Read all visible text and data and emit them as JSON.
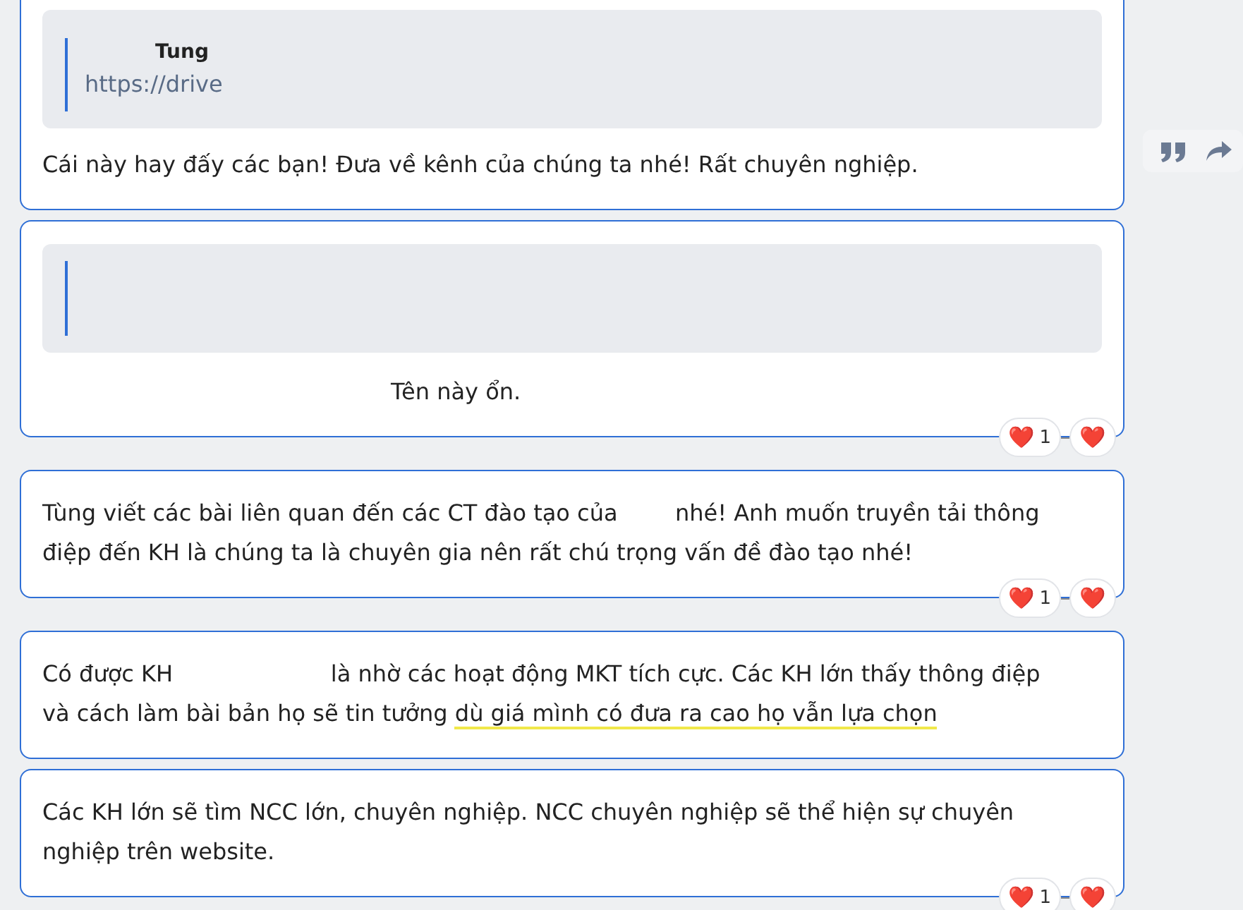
{
  "messages": [
    {
      "kind": "quoted",
      "quote": {
        "author": "Tung",
        "text": "https://drive"
      },
      "lines": [
        [
          {
            "text": "Cái này hay đấy các bạn! Đưa về kênh của chúng ta nhé! Rất chuyên nghiệp.",
            "underlined": false
          }
        ]
      ]
    },
    {
      "kind": "reply",
      "lines": [
        [
          {
            "text": "Tên này ổn.",
            "underlined": false
          }
        ]
      ],
      "reactions": [
        {
          "emoji": "❤️",
          "count": "1"
        },
        {
          "emoji": "❤️"
        }
      ]
    },
    {
      "kind": "plain",
      "lines": [
        [
          {
            "text": "Tùng viết các bài liên quan đến các CT đào tạo của        nhé! Anh muốn truyền tải thông",
            "underlined": false
          }
        ],
        [
          {
            "text": "điệp đến KH là chúng ta là chuyên gia nên rất chú trọng vấn đề đào tạo nhé!",
            "underlined": false
          }
        ]
      ],
      "reactions": [
        {
          "emoji": "❤️",
          "count": "1"
        },
        {
          "emoji": "❤️"
        }
      ]
    },
    {
      "kind": "plain",
      "lines": [
        [
          {
            "text": "Có được KH                      là nhờ các hoạt động MKT tích cực. Các KH lớn thấy thông điệp",
            "underlined": false
          }
        ],
        [
          {
            "text": "và cách làm bài bản họ sẽ tin tưởng ",
            "underlined": false
          },
          {
            "text": "dù giá mình có đưa ra cao họ vẫn lựa chọn",
            "underlined": true
          }
        ]
      ]
    },
    {
      "kind": "plain",
      "lines": [
        [
          {
            "text": "Các KH lớn sẽ tìm NCC lớn, chuyên nghiệp. NCC chuyên nghiệp sẽ thể hiện sự chuyên",
            "underlined": false
          }
        ],
        [
          {
            "text": "nghiệp trên website.",
            "underlined": false
          }
        ]
      ],
      "reactions": [
        {
          "emoji": "❤️",
          "count": "1"
        },
        {
          "emoji": "❤️"
        }
      ]
    }
  ]
}
